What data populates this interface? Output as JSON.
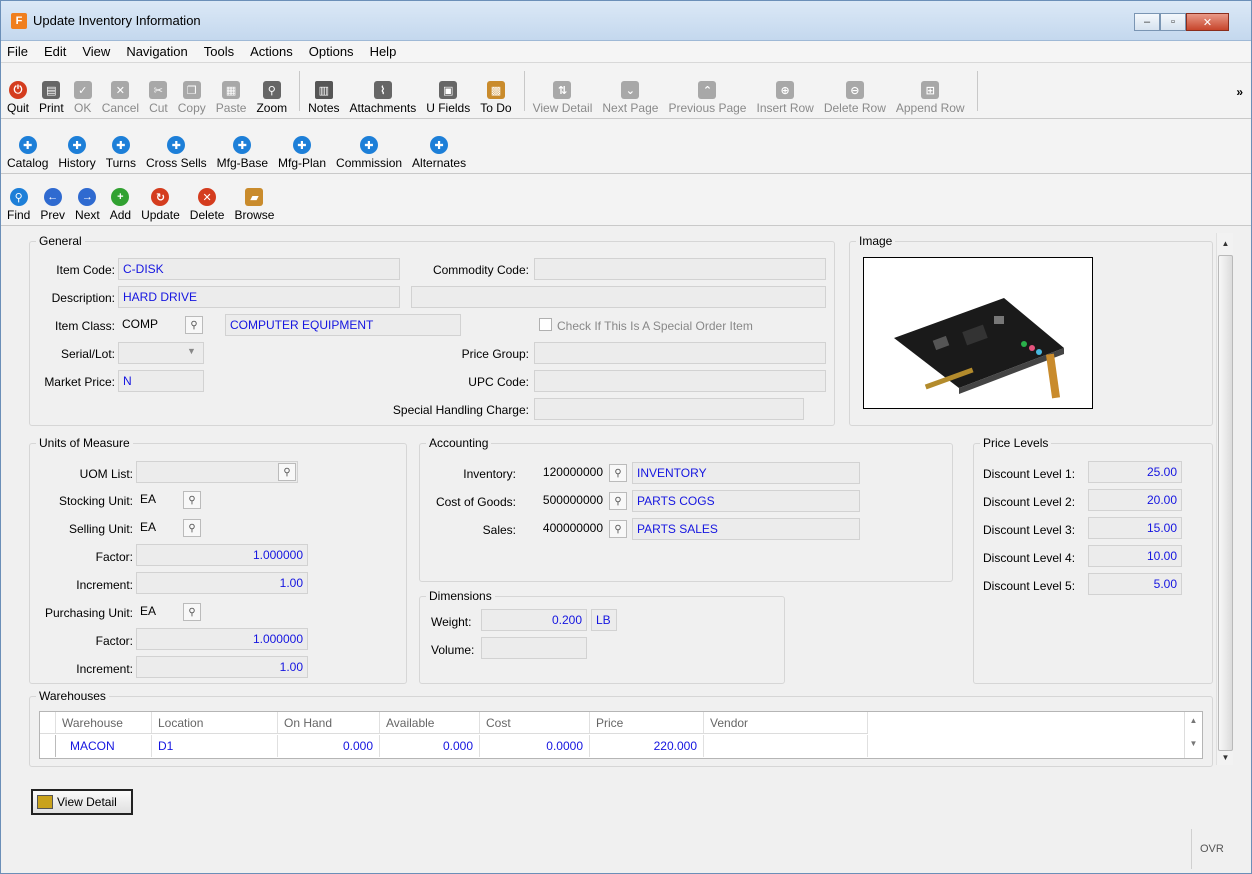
{
  "window": {
    "title": "Update Inventory Information",
    "app_icon_letter": "F",
    "minimize": "–",
    "maximize": "▫",
    "close": "✕"
  },
  "menu": [
    "File",
    "Edit",
    "View",
    "Navigation",
    "Tools",
    "Actions",
    "Options",
    "Help"
  ],
  "toolbar1": {
    "quit": "Quit",
    "print": "Print",
    "ok": "OK",
    "cancel": "Cancel",
    "cut": "Cut",
    "copy": "Copy",
    "paste": "Paste",
    "zoom": "Zoom",
    "notes": "Notes",
    "attachments": "Attachments",
    "ufields": "U Fields",
    "todo": "To Do",
    "view_detail": "View Detail",
    "next_page": "Next Page",
    "previous_page": "Previous Page",
    "insert_row": "Insert Row",
    "delete_row": "Delete Row",
    "append_row": "Append Row",
    "overflow": "»"
  },
  "toolbar2": {
    "catalog": "Catalog",
    "history": "History",
    "turns": "Turns",
    "cross_sells": "Cross Sells",
    "mfg_base": "Mfg-Base",
    "mfg_plan": "Mfg-Plan",
    "commission": "Commission",
    "alternates": "Alternates"
  },
  "toolbar3": {
    "find": "Find",
    "prev": "Prev",
    "next": "Next",
    "add": "Add",
    "update": "Update",
    "delete": "Delete",
    "browse": "Browse"
  },
  "general": {
    "legend": "General",
    "item_code_label": "Item Code:",
    "item_code": "C-DISK",
    "commodity_code_label": "Commodity Code:",
    "commodity_code": "",
    "description_label": "Description:",
    "description": "HARD DRIVE",
    "item_class_label": "Item Class:",
    "item_class": "COMP",
    "item_class_desc": "COMPUTER EQUIPMENT",
    "special_order_label": "Check If This Is A Special Order Item",
    "serial_lot_label": "Serial/Lot:",
    "serial_lot": "",
    "price_group_label": "Price Group:",
    "price_group": "",
    "market_price_label": "Market Price:",
    "market_price": "N",
    "upc_code_label": "UPC Code:",
    "upc_code": "",
    "special_handling_label": "Special Handling Charge:",
    "special_handling": ""
  },
  "image": {
    "legend": "Image"
  },
  "uom": {
    "legend": "Units of Measure",
    "uom_list_label": "UOM List:",
    "uom_list": "",
    "stocking_unit_label": "Stocking Unit:",
    "stocking_unit": "EA",
    "selling_unit_label": "Selling Unit:",
    "selling_unit": "EA",
    "factor_label": "Factor:",
    "selling_factor": "1.000000",
    "increment_label": "Increment:",
    "selling_increment": "1.00",
    "purchasing_unit_label": "Purchasing Unit:",
    "purchasing_unit": "EA",
    "purchasing_factor": "1.000000",
    "purchasing_increment": "1.00"
  },
  "accounting": {
    "legend": "Accounting",
    "inventory_label": "Inventory:",
    "inventory_acct": "120000000",
    "inventory_desc": "INVENTORY",
    "cogs_label": "Cost of Goods:",
    "cogs_acct": "500000000",
    "cogs_desc": "PARTS COGS",
    "sales_label": "Sales:",
    "sales_acct": "400000000",
    "sales_desc": "PARTS SALES"
  },
  "dimensions": {
    "legend": "Dimensions",
    "weight_label": "Weight:",
    "weight": "0.200",
    "weight_unit": "LB",
    "volume_label": "Volume:",
    "volume": ""
  },
  "price_levels": {
    "legend": "Price Levels",
    "levels": [
      {
        "label": "Discount Level 1:",
        "value": "25.00"
      },
      {
        "label": "Discount Level 2:",
        "value": "20.00"
      },
      {
        "label": "Discount Level 3:",
        "value": "15.00"
      },
      {
        "label": "Discount Level 4:",
        "value": "10.00"
      },
      {
        "label": "Discount Level 5:",
        "value": "5.00"
      }
    ]
  },
  "warehouses": {
    "legend": "Warehouses",
    "columns": [
      "Warehouse",
      "Location",
      "On Hand",
      "Available",
      "Cost",
      "Price",
      "Vendor"
    ],
    "rows": [
      {
        "warehouse": "MACON",
        "location": "D1",
        "on_hand": "0.000",
        "available": "0.000",
        "cost": "0.0000",
        "price": "220.000",
        "vendor": ""
      }
    ]
  },
  "footer": {
    "view_detail": "View Detail",
    "ovr": "OVR"
  }
}
